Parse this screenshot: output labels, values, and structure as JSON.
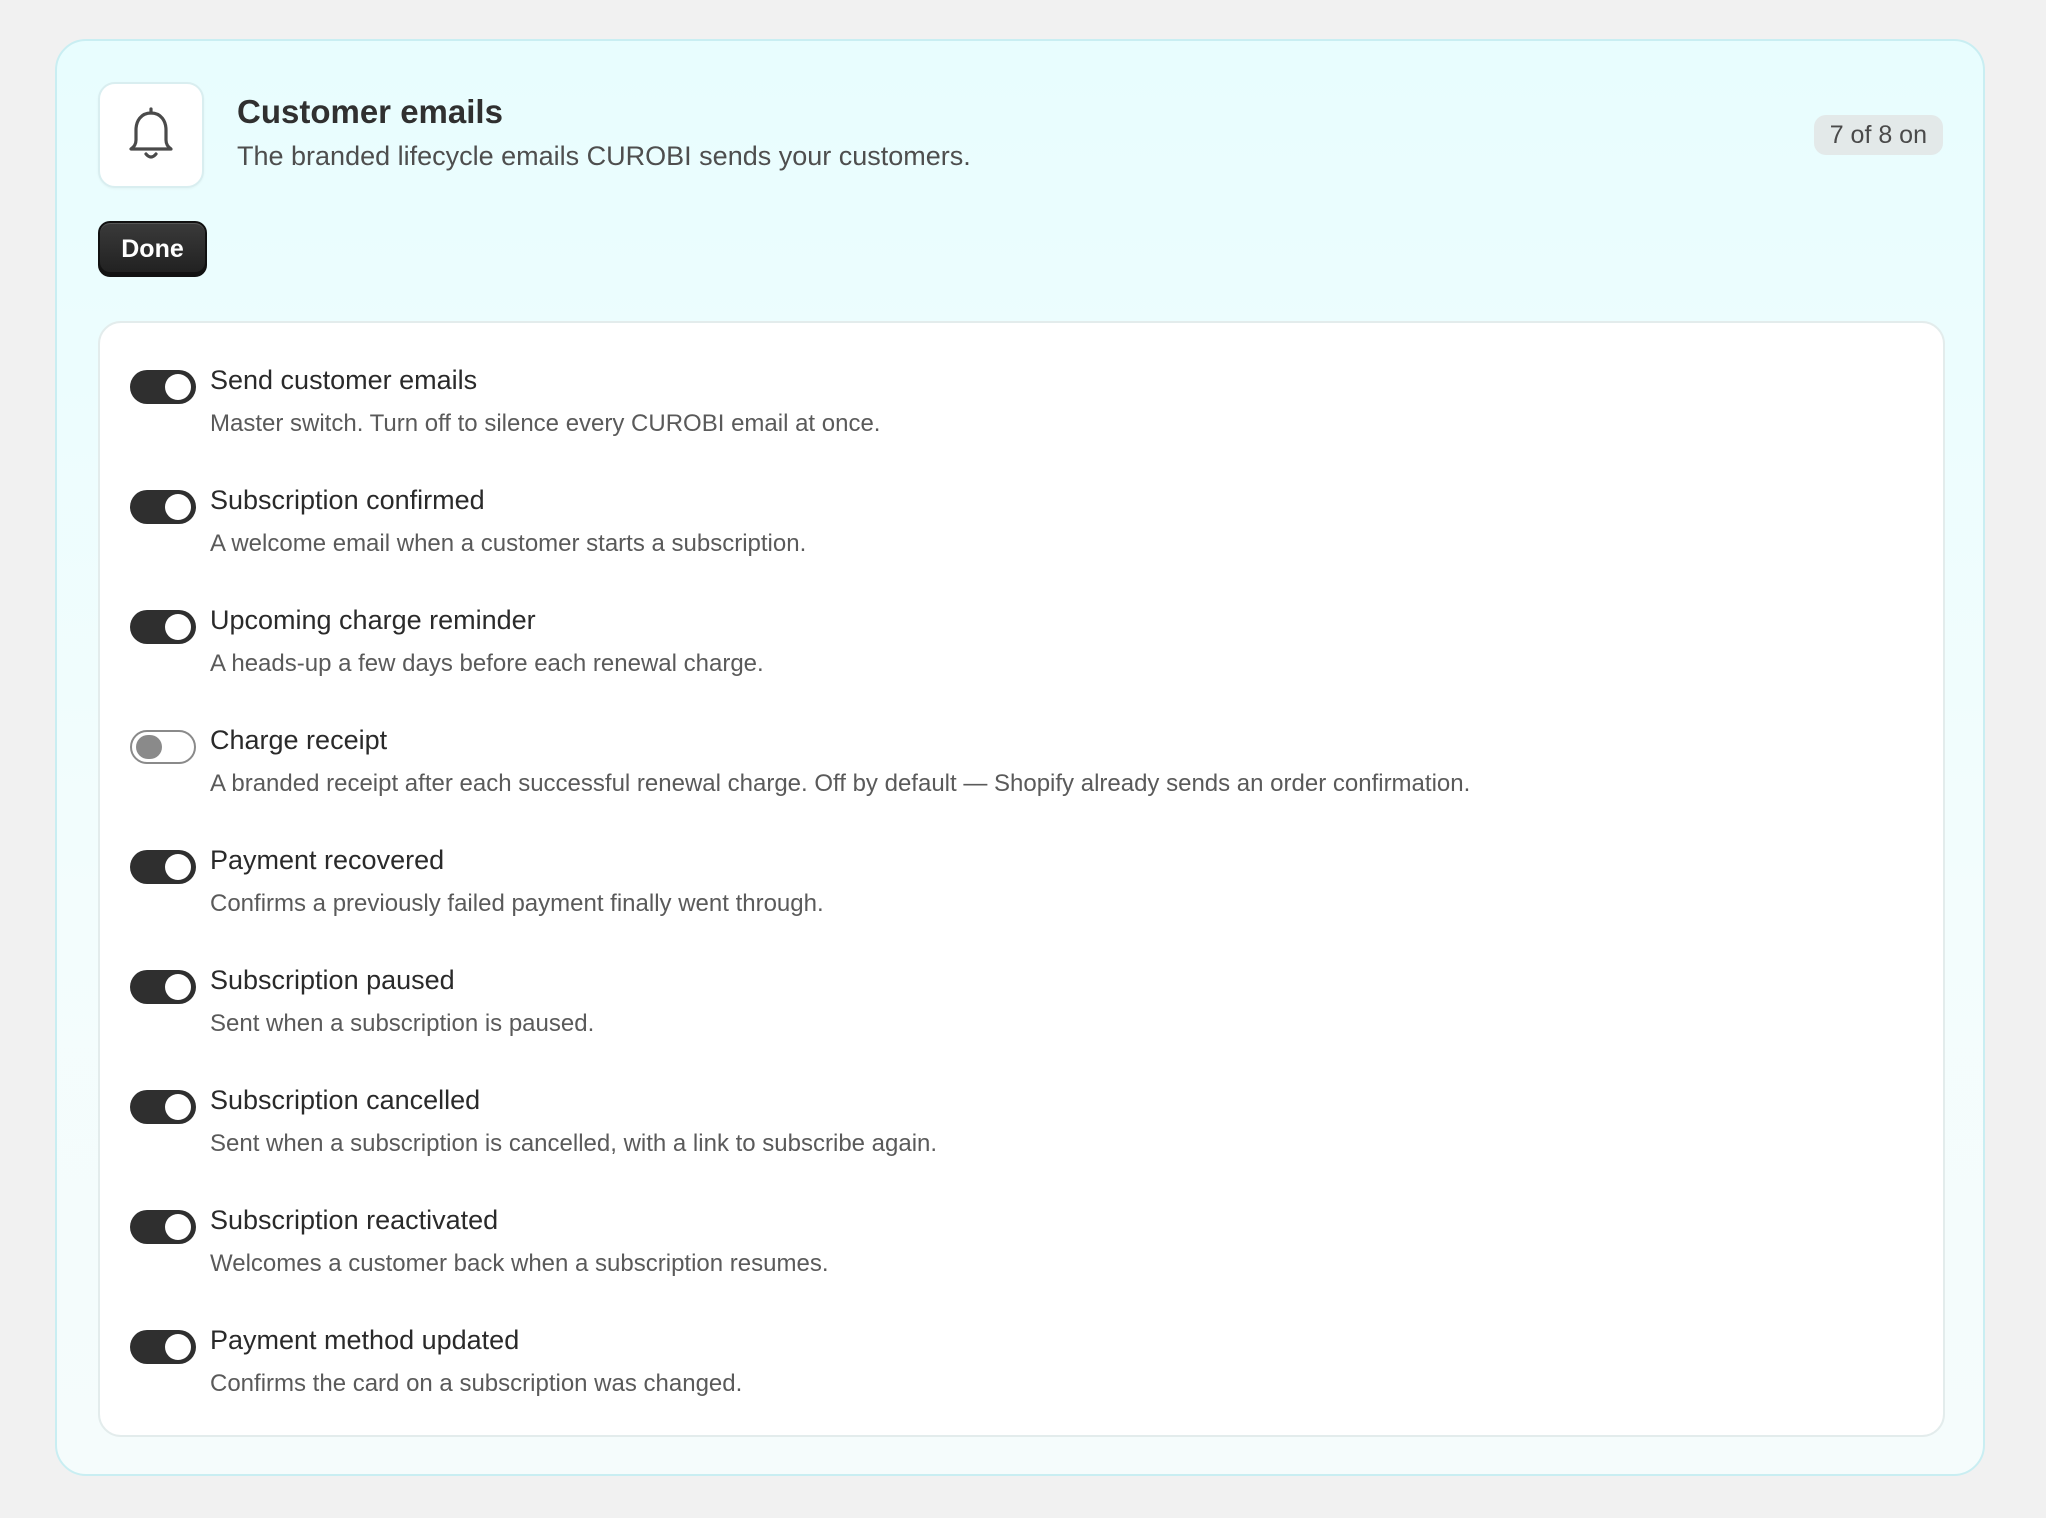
{
  "header": {
    "icon": "bell-icon",
    "title": "Customer emails",
    "subtitle": "The branded lifecycle emails CUROBI sends your customers.",
    "count_badge": "7 of 8 on"
  },
  "actions": {
    "done_label": "Done"
  },
  "colors": {
    "toggle_on": "#2f2f2f",
    "toggle_off": "#8a8a8a",
    "card_border": "#c9eef2",
    "card_background": "#e8fdfe"
  },
  "settings": [
    {
      "title": "Send customer emails",
      "description": "Master switch. Turn off to silence every CUROBI email at once.",
      "enabled": true
    },
    {
      "title": "Subscription confirmed",
      "description": "A welcome email when a customer starts a subscription.",
      "enabled": true
    },
    {
      "title": "Upcoming charge reminder",
      "description": "A heads-up a few days before each renewal charge.",
      "enabled": true
    },
    {
      "title": "Charge receipt",
      "description": "A branded receipt after each successful renewal charge. Off by default — Shopify already sends an order confirmation.",
      "enabled": false
    },
    {
      "title": "Payment recovered",
      "description": "Confirms a previously failed payment finally went through.",
      "enabled": true
    },
    {
      "title": "Subscription paused",
      "description": "Sent when a subscription is paused.",
      "enabled": true
    },
    {
      "title": "Subscription cancelled",
      "description": "Sent when a subscription is cancelled, with a link to subscribe again.",
      "enabled": true
    },
    {
      "title": "Subscription reactivated",
      "description": "Welcomes a customer back when a subscription resumes.",
      "enabled": true
    },
    {
      "title": "Payment method updated",
      "description": "Confirms the card on a subscription was changed.",
      "enabled": true
    }
  ]
}
